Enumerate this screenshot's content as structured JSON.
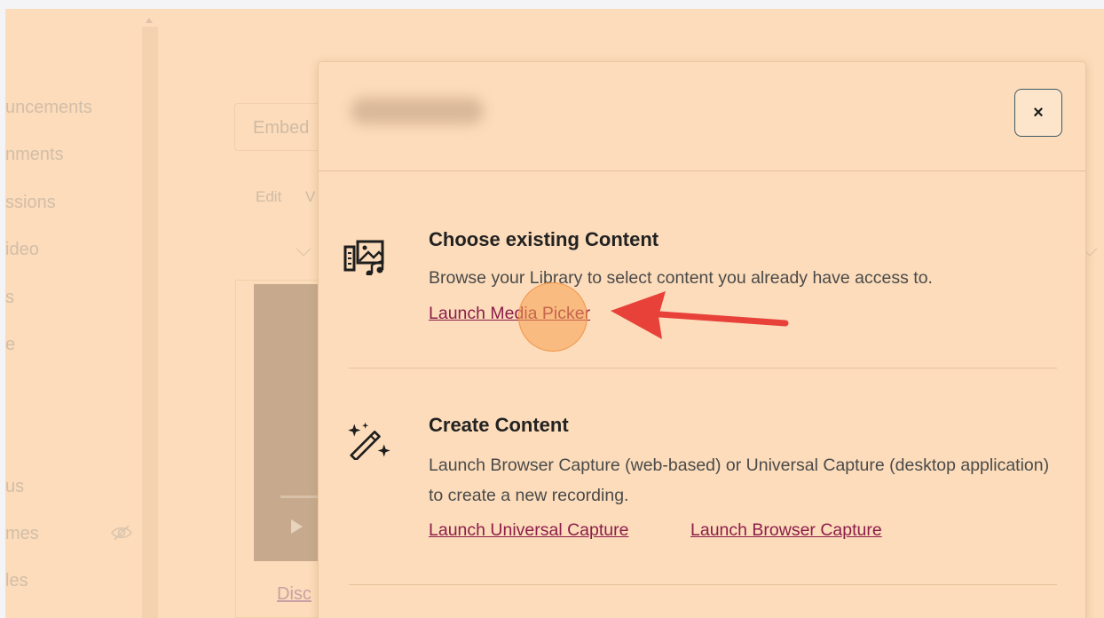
{
  "background_sidebar": {
    "items": [
      {
        "label": "uncements"
      },
      {
        "label": "nments"
      },
      {
        "label": "ssions"
      },
      {
        "label": "ideo"
      },
      {
        "label": "s"
      },
      {
        "label": "e"
      },
      {
        "label": "us"
      },
      {
        "label": "mes"
      },
      {
        "label": "les"
      }
    ],
    "hidden_icon": "eye-slash-icon"
  },
  "background_page": {
    "input_placeholder": "Embed",
    "tabs": [
      "Edit",
      "V"
    ],
    "link_text": "Disc"
  },
  "modal": {
    "close_label": "×",
    "sections": [
      {
        "icon": "media-library-icon",
        "title": "Choose existing Content",
        "description": "Browse your Library to select content you already have access to.",
        "links": [
          "Launch Media Picker"
        ]
      },
      {
        "icon": "magic-wand-icon",
        "title": "Create Content",
        "description": "Launch Browser Capture (web-based) or Universal Capture (desktop application) to create a new recording.",
        "links": [
          "Launch Universal Capture",
          "Launch Browser Capture"
        ]
      }
    ]
  },
  "colors": {
    "overlay": "#fcdcba",
    "link": "#8c1d4a",
    "close_border": "#3e5963",
    "arrow": "#e8413a"
  }
}
